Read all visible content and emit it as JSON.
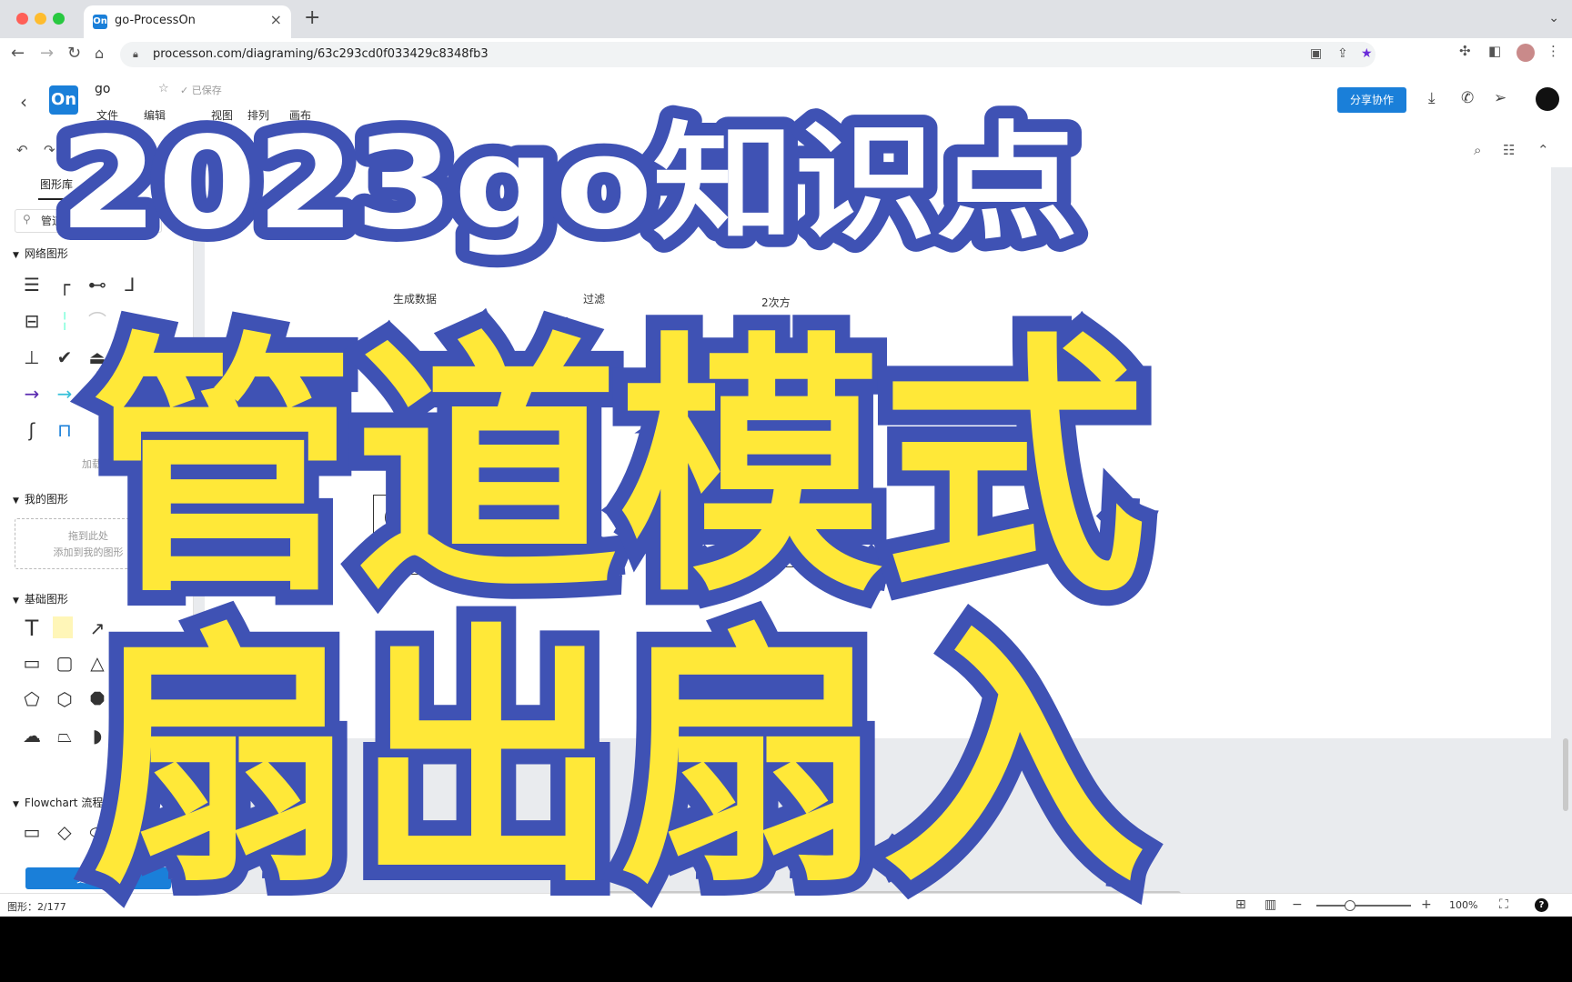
{
  "browser": {
    "tab_title": "go-ProcessOn",
    "tab_favicon": "On",
    "url": "processon.com/diagraming/63c293cd0f033429c8348fb3"
  },
  "app": {
    "logo": "On",
    "doc_title": "go",
    "save_status": "已保存",
    "menu": [
      "文件",
      "编辑",
      "视图",
      "排列",
      "画布"
    ],
    "share_label": "分享协作"
  },
  "sidebar": {
    "tab_label": "图形库",
    "search_value": "管道",
    "sections": {
      "network": "网络图形",
      "mine": "我的图形",
      "basic": "基础图形",
      "flowchart": "Flowchart 流程图"
    },
    "load_more": "加载更多",
    "dropzone_line1": "拖到此处",
    "dropzone_line2": "添加到我的图形",
    "more_shapes": "更多图形"
  },
  "diagram": {
    "labels": [
      "生成数据",
      "过滤",
      "2次方"
    ],
    "node_text": "go"
  },
  "status": {
    "shape_count": "图形：2/177",
    "zoom": "100%"
  },
  "overlay": {
    "line1": "2023go知识点",
    "line2": "管道模式",
    "line3": "扇出扇入",
    "fill_top": "#ffffff",
    "fill_main": "#ffe838",
    "stroke": "#3f52b4"
  },
  "colors": {
    "accent": "#1a7fd9"
  }
}
